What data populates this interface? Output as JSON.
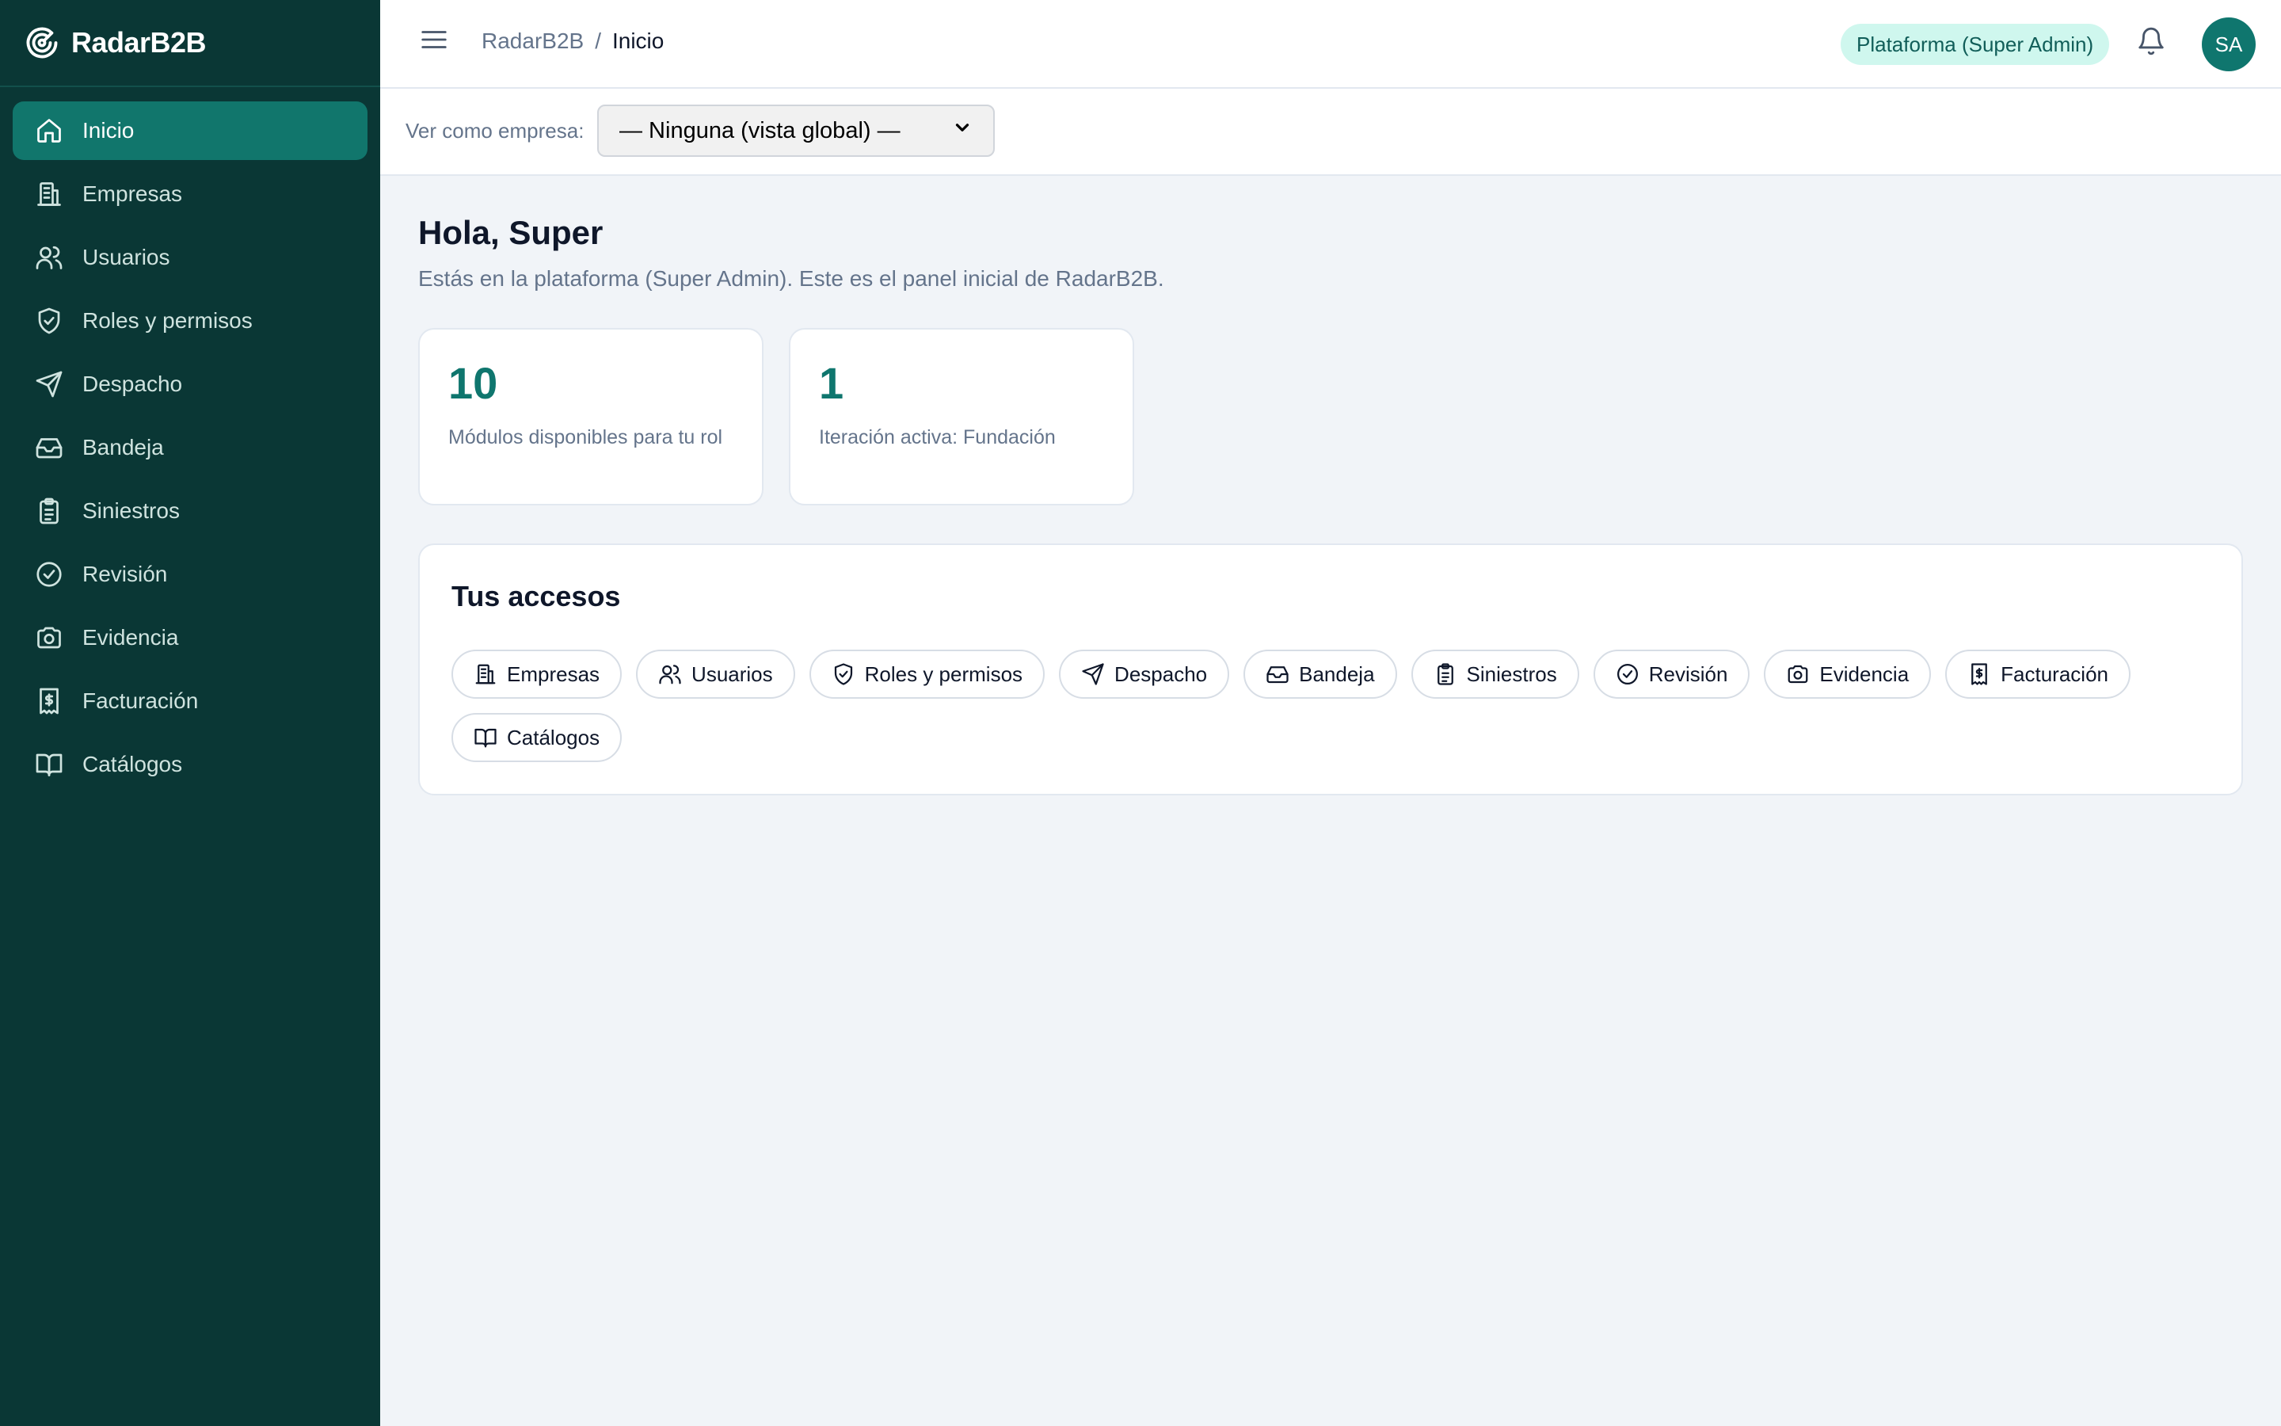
{
  "brand": {
    "name": "RadarB2B",
    "icon": "radar-logo-icon"
  },
  "sidebar": {
    "items": [
      {
        "label": "Inicio",
        "icon": "home-icon",
        "active": true
      },
      {
        "label": "Empresas",
        "icon": "building-icon"
      },
      {
        "label": "Usuarios",
        "icon": "users-icon"
      },
      {
        "label": "Roles y permisos",
        "icon": "shield-icon"
      },
      {
        "label": "Despacho",
        "icon": "send-icon"
      },
      {
        "label": "Bandeja",
        "icon": "inbox-icon"
      },
      {
        "label": "Siniestros",
        "icon": "clipboard-icon"
      },
      {
        "label": "Revisión",
        "icon": "check-circle-icon"
      },
      {
        "label": "Evidencia",
        "icon": "camera-icon"
      },
      {
        "label": "Facturación",
        "icon": "receipt-icon"
      },
      {
        "label": "Catálogos",
        "icon": "book-icon"
      }
    ]
  },
  "topbar": {
    "breadcrumb_parent": "RadarB2B",
    "breadcrumb_sep": "/",
    "breadcrumb_current": "Inicio",
    "role_badge": "Plataforma (Super Admin)",
    "avatar_initials": "SA"
  },
  "company_bar": {
    "label": "Ver como empresa:",
    "selected": "— Ninguna (vista global) —"
  },
  "main": {
    "greeting": "Hola, Super",
    "subtitle": "Estás en la plataforma (Super Admin). Este es el panel inicial de RadarB2B.",
    "stats": [
      {
        "value": "10",
        "label": "Módulos disponibles para tu rol"
      },
      {
        "value": "1",
        "label": "Iteración activa: Fundación"
      }
    ],
    "access": {
      "title": "Tus accesos",
      "chips": [
        {
          "label": "Empresas",
          "icon": "building-icon"
        },
        {
          "label": "Usuarios",
          "icon": "users-icon"
        },
        {
          "label": "Roles y permisos",
          "icon": "shield-icon"
        },
        {
          "label": "Despacho",
          "icon": "send-icon"
        },
        {
          "label": "Bandeja",
          "icon": "inbox-icon"
        },
        {
          "label": "Siniestros",
          "icon": "clipboard-icon"
        },
        {
          "label": "Revisión",
          "icon": "check-circle-icon"
        },
        {
          "label": "Evidencia",
          "icon": "camera-icon"
        },
        {
          "label": "Facturación",
          "icon": "receipt-icon"
        },
        {
          "label": "Catálogos",
          "icon": "book-icon"
        }
      ]
    }
  },
  "colors": {
    "sidebar_bg": "#0a3735",
    "active_item": "#11766c",
    "accent": "#0f766e",
    "badge_bg": "#cff7ee",
    "page_bg": "#f1f4f8"
  }
}
